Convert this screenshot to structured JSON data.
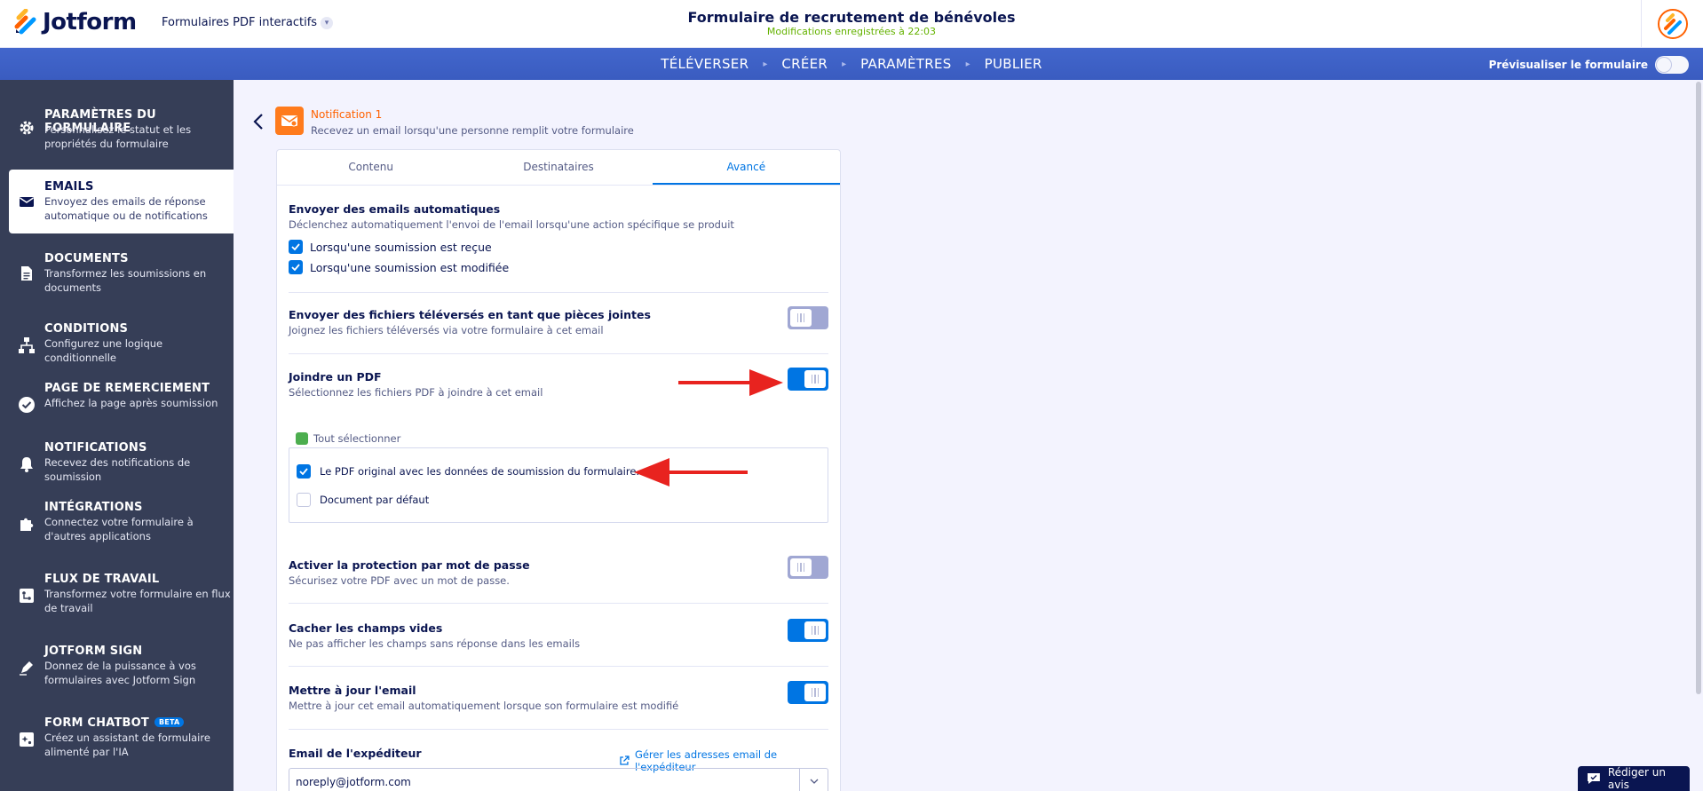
{
  "brand": {
    "name": "Jotform",
    "product": "Formulaires PDF interactifs"
  },
  "header": {
    "form_title": "Formulaire de recrutement de bénévoles",
    "save_status": "Modifications enregistrées à 22:03"
  },
  "nav": {
    "items": [
      "TÉLÉVERSER",
      "CRÉER",
      "PARAMÈTRES",
      "PUBLIER"
    ],
    "preview_label": "Prévisualiser le formulaire"
  },
  "sidebar": {
    "items": [
      {
        "title": "PARAMÈTRES DU FORMULAIRE",
        "desc": "Personnalisez le statut et les propriétés du formulaire",
        "icon": "gear-icon"
      },
      {
        "title": "EMAILS",
        "desc": "Envoyez des emails de réponse automatique ou de notifications",
        "icon": "envelope-icon"
      },
      {
        "title": "DOCUMENTS",
        "desc": "Transformez les soumissions en documents",
        "icon": "document-icon"
      },
      {
        "title": "CONDITIONS",
        "desc": "Configurez une logique conditionnelle",
        "icon": "hierarchy-icon"
      },
      {
        "title": "PAGE DE REMERCIEMENT",
        "desc": "Affichez la page après soumission",
        "icon": "check-circle-icon"
      },
      {
        "title": "NOTIFICATIONS",
        "desc": "Recevez des notifications de soumission",
        "icon": "bell-icon"
      },
      {
        "title": "INTÉGRATIONS",
        "desc": "Connectez votre formulaire à d'autres applications",
        "icon": "puzzle-icon"
      },
      {
        "title": "FLUX DE TRAVAIL",
        "desc": "Transformez votre formulaire en flux de travail",
        "icon": "workflow-icon"
      },
      {
        "title": "JOTFORM SIGN",
        "desc": "Donnez de la puissance à vos formulaires avec Jotform Sign",
        "icon": "pen-icon"
      },
      {
        "title": "FORM CHATBOT",
        "desc": "Créez un assistant de formulaire alimenté par l'IA",
        "icon": "chatbot-icon",
        "badge": "BETA"
      }
    ]
  },
  "notification": {
    "title": "Notification 1",
    "subtitle": "Recevez un email lorsqu'une personne remplit votre formulaire"
  },
  "tabs": [
    "Contenu",
    "Destinataires",
    "Avancé"
  ],
  "advanced": {
    "auto_emails": {
      "title": "Envoyer des emails automatiques",
      "desc": "Déclenchez automatiquement l'envoi de l'email lorsqu'une action spécifique se produit",
      "options": [
        "Lorsqu'une soumission est reçue",
        "Lorsqu'une soumission est modifiée"
      ]
    },
    "attachments": {
      "title": "Envoyer des fichiers téléversés en tant que pièces jointes",
      "desc": "Joignez les fichiers téléversés via votre formulaire à cet email"
    },
    "attach_pdf": {
      "title": "Joindre un PDF",
      "desc": "Sélectionnez les fichiers PDF à joindre à cet email",
      "select_all": "Tout sélectionner",
      "options": [
        "Le PDF original avec les données de soumission du formulaire.",
        "Document par défaut"
      ]
    },
    "password": {
      "title": "Activer la protection par mot de passe",
      "desc": "Sécurisez votre PDF avec un mot de passe."
    },
    "hide_empty": {
      "title": "Cacher les champs vides",
      "desc": "Ne pas afficher les champs sans réponse dans les emails"
    },
    "update_email": {
      "title": "Mettre à jour l'email",
      "desc": "Mettre à jour cet email automatiquement lorsque son formulaire est modifié"
    },
    "sender": {
      "title": "Email de l'expéditeur",
      "manage_link": "Gérer les adresses email de l'expéditeur",
      "value": "noreply@jotform.com"
    }
  },
  "review_button": "Rédiger un avis",
  "colors": {
    "accent": "#0075e3",
    "brand_orange": "#ff6100",
    "sidebar_bg": "#363e57",
    "nav_bg": "#3e62c8",
    "arrow_red": "#e8231f"
  }
}
